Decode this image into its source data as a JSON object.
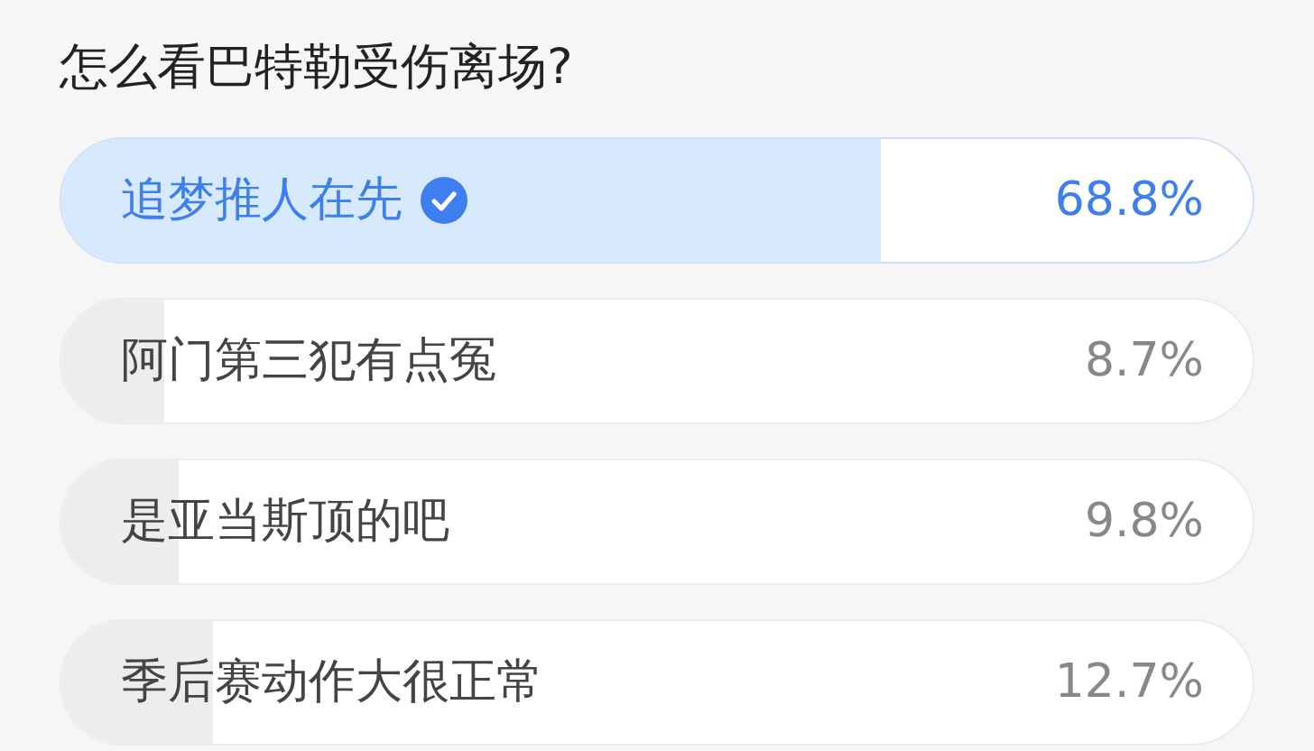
{
  "question": "怎么看巴特勒受伤离场?",
  "options": [
    {
      "label": "追梦推人在先",
      "percent": "68.8%",
      "level": 0.688,
      "selected": true
    },
    {
      "label": "阿门第三犯有点冤",
      "percent": "8.7%",
      "level": 0.087,
      "selected": false
    },
    {
      "label": "是亚当斯顶的吧",
      "percent": "9.8%",
      "level": 0.098,
      "selected": false
    },
    {
      "label": "季后赛动作大很正常",
      "percent": "12.7%",
      "level": 0.127,
      "selected": false
    }
  ]
}
